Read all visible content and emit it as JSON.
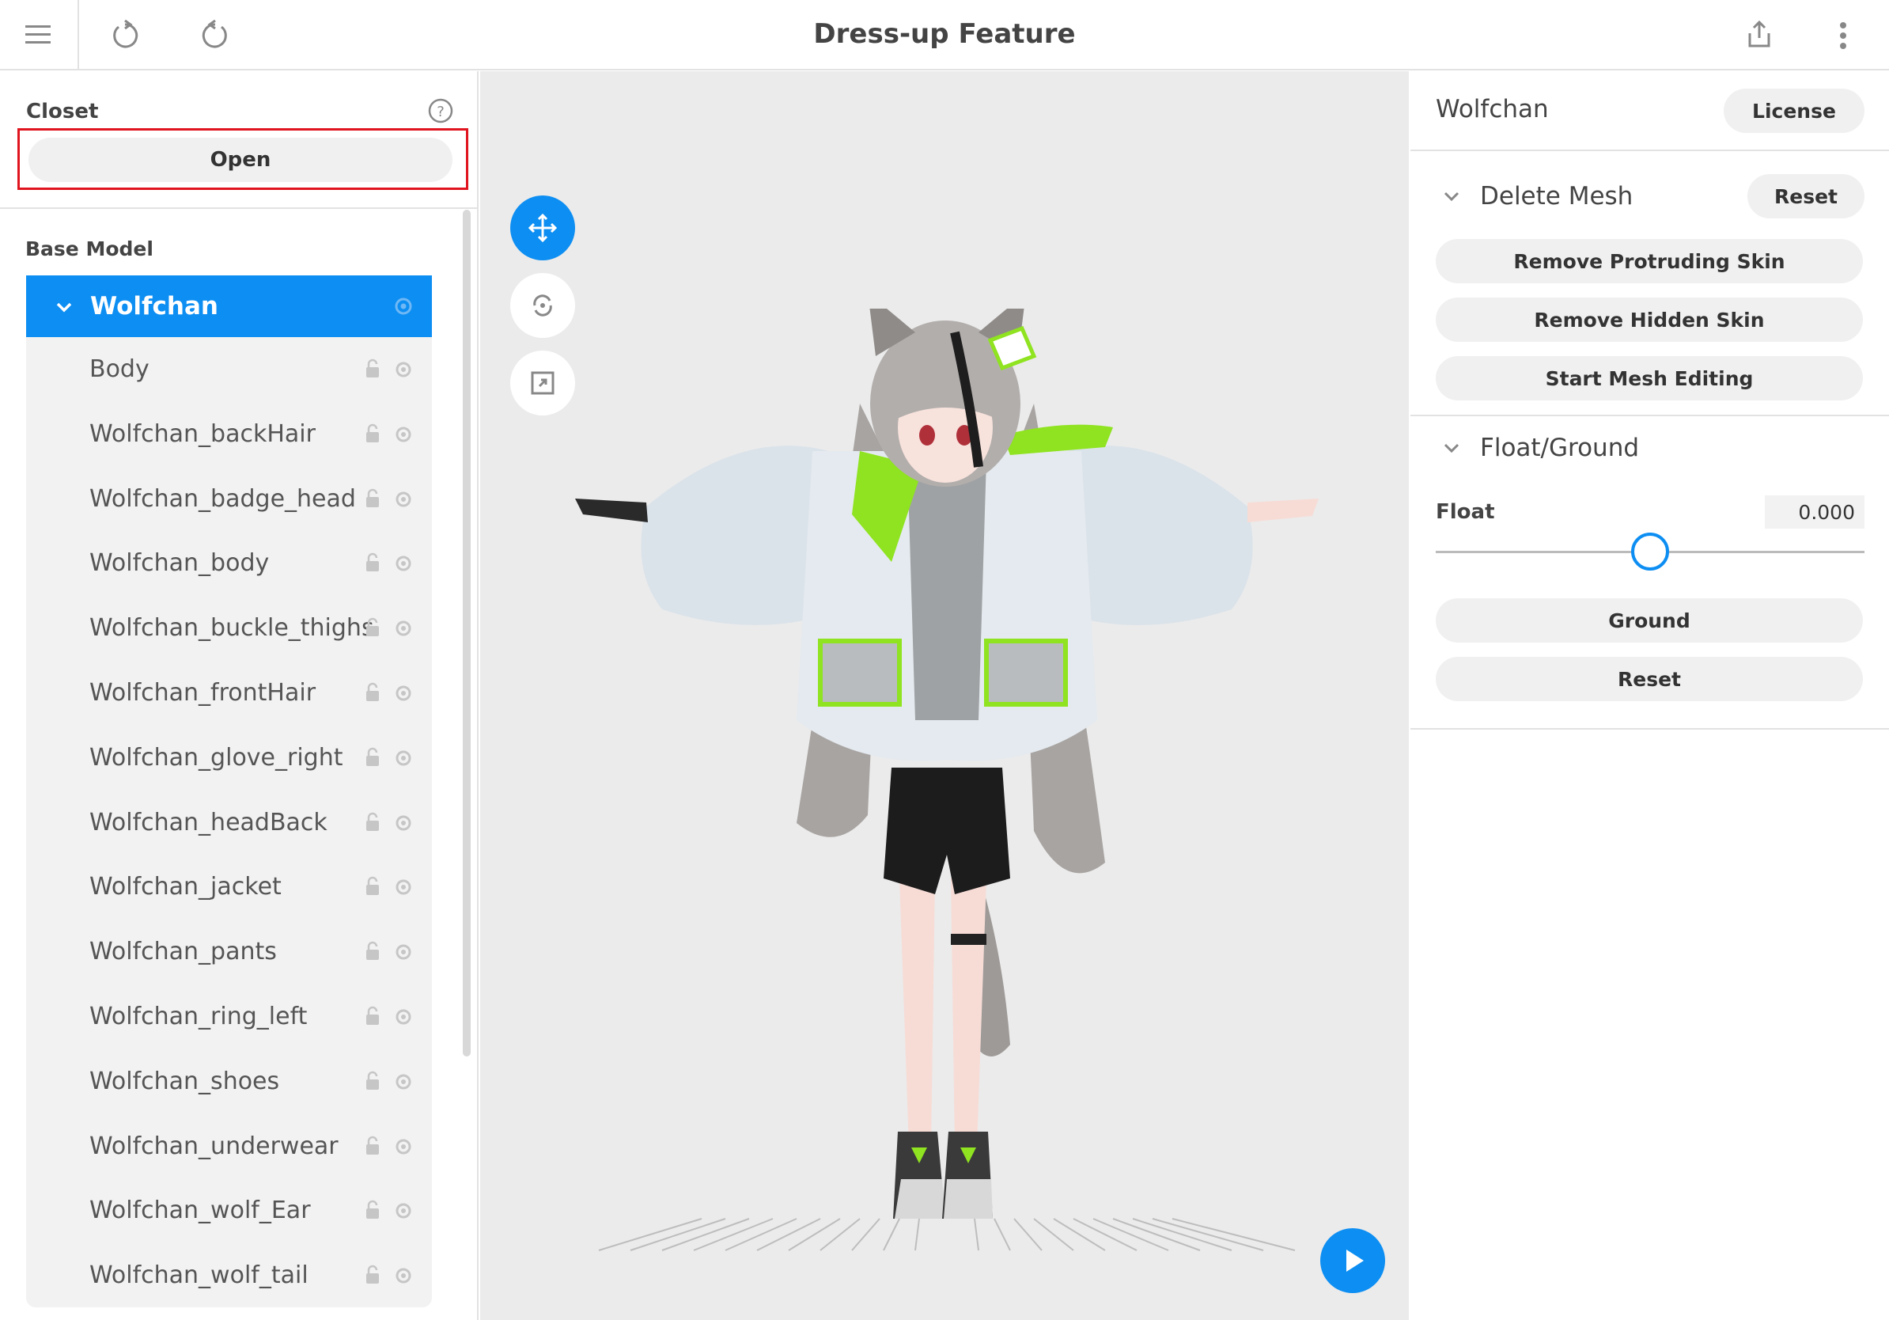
{
  "app": {
    "title": "Dress-up Feature"
  },
  "toolbar": {
    "icons": [
      "menu-icon",
      "undo-icon",
      "redo-icon",
      "share-icon",
      "more-vertical-icon"
    ]
  },
  "closet": {
    "label": "Closet",
    "open_label": "Open"
  },
  "base_model": {
    "label": "Base Model",
    "root": "Wolfchan",
    "items": [
      "Body",
      "Wolfchan_backHair",
      "Wolfchan_badge_head",
      "Wolfchan_body",
      "Wolfchan_buckle_thighs",
      "Wolfchan_frontHair",
      "Wolfchan_glove_right",
      "Wolfchan_headBack",
      "Wolfchan_jacket",
      "Wolfchan_pants",
      "Wolfchan_ring_left",
      "Wolfchan_shoes",
      "Wolfchan_underwear",
      "Wolfchan_wolf_Ear",
      "Wolfchan_wolf_tail"
    ]
  },
  "viewport": {
    "tools": [
      "move-icon",
      "rotate-icon",
      "zoom-fit-icon"
    ],
    "play_icon": "play-icon"
  },
  "inspector": {
    "model_name": "Wolfchan",
    "license_label": "License",
    "delete_mesh": {
      "title": "Delete Mesh",
      "reset_label": "Reset",
      "buttons": [
        "Remove Protruding Skin",
        "Remove Hidden Skin",
        "Start Mesh Editing"
      ]
    },
    "float_ground": {
      "title": "Float/Ground",
      "float_label": "Float",
      "float_value": "0.000",
      "slider_fraction": 0.5,
      "ground_label": "Ground",
      "reset_label": "Reset"
    }
  },
  "colors": {
    "accent": "#0d8ef2",
    "highlight": "#e0141e",
    "lime": "#8fe320"
  }
}
